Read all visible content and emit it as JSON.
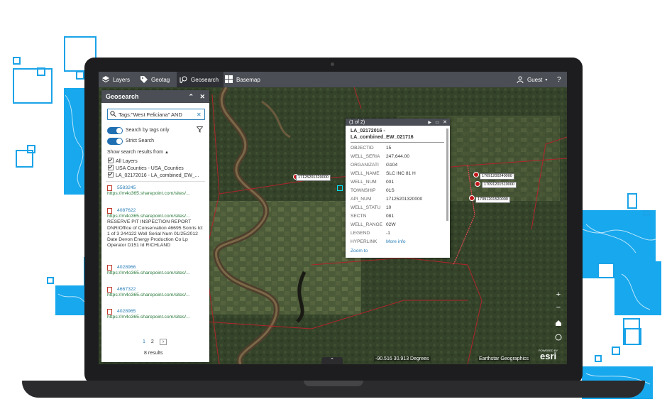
{
  "toolbar": {
    "layers_label": "Layers",
    "geotag_label": "Geotag",
    "geosearch_label": "Geosearch",
    "basemap_label": "Basemap",
    "user_label": "Guest",
    "help_label": "?"
  },
  "geosearch": {
    "title": "Geosearch",
    "search_value": "Tags:\"West Feliciana\" AND",
    "search_by_tags_label": "Search by tags only",
    "strict_search_label": "Strict Search",
    "show_results_label": "Show search results from",
    "layers": [
      "All Layers",
      "USA Counties - USA_Counties",
      "LA_02172016 - LA_combined_EW_..."
    ],
    "results": [
      {
        "id": "5583245",
        "url": "https://m4o365.sharepoint.com/sites/...",
        "desc": ""
      },
      {
        "id": "4087622",
        "url": "https://m4o365.sharepoint.com/sites/...",
        "desc": "RESERVE PIT INSPECTION REPORT DNR/Office of Conservation 46695 Sonris Id: 1 of 3 244122 Well Serial Num 01/25/2012 Date Devon Energy Production Co Lp Operator D151 Id RICHLAND"
      },
      {
        "id": "4028966",
        "url": "https://m4o365.sharepoint.com/sites/...",
        "desc": ""
      },
      {
        "id": "4667322",
        "url": "https://m4o365.sharepoint.com/sites/...",
        "desc": ""
      },
      {
        "id": "4028965",
        "url": "https://m4o365.sharepoint.com/sites/...",
        "desc": ""
      }
    ],
    "pages": [
      "1",
      "2"
    ],
    "next_label": "›",
    "results_count": "8 results"
  },
  "popup": {
    "counter": "(1 of 2)",
    "title": "LA_02172016 - LA_combined_EW_021716",
    "fields": [
      {
        "k": "OBJECTID",
        "v": "15"
      },
      {
        "k": "WELL_SERIA",
        "v": "247,644.00"
      },
      {
        "k": "ORGANIZATI",
        "v": "G104"
      },
      {
        "k": "WELL_NAME",
        "v": "SLC INC 81 H"
      },
      {
        "k": "WELL_NUM",
        "v": "001"
      },
      {
        "k": "TOWNSHIP",
        "v": "01S"
      },
      {
        "k": "API_NUM",
        "v": "17125201320000"
      },
      {
        "k": "WELL_STATU",
        "v": "10"
      },
      {
        "k": "SECTN",
        "v": "081"
      },
      {
        "k": "WELL_RANGE",
        "v": "02W"
      },
      {
        "k": "LEGEND",
        "v": "-1"
      },
      {
        "k": "HYPERLINK",
        "v": "More info"
      }
    ],
    "zoom_label": "Zoom to"
  },
  "map": {
    "labels": [
      "17125201320000",
      "17091200240000",
      "17091201510000",
      "17091201520000"
    ],
    "coords": "-90.516 30.913 Degrees",
    "attribution": "Earthstar Geographics",
    "esri_powered": "POWERED BY",
    "esri_logo": "esri",
    "collapse_label": "⌃"
  },
  "colors": {
    "brand_blue": "#17a8ee",
    "toolbar": "#4b4e55",
    "boundary": "#b0242a"
  }
}
